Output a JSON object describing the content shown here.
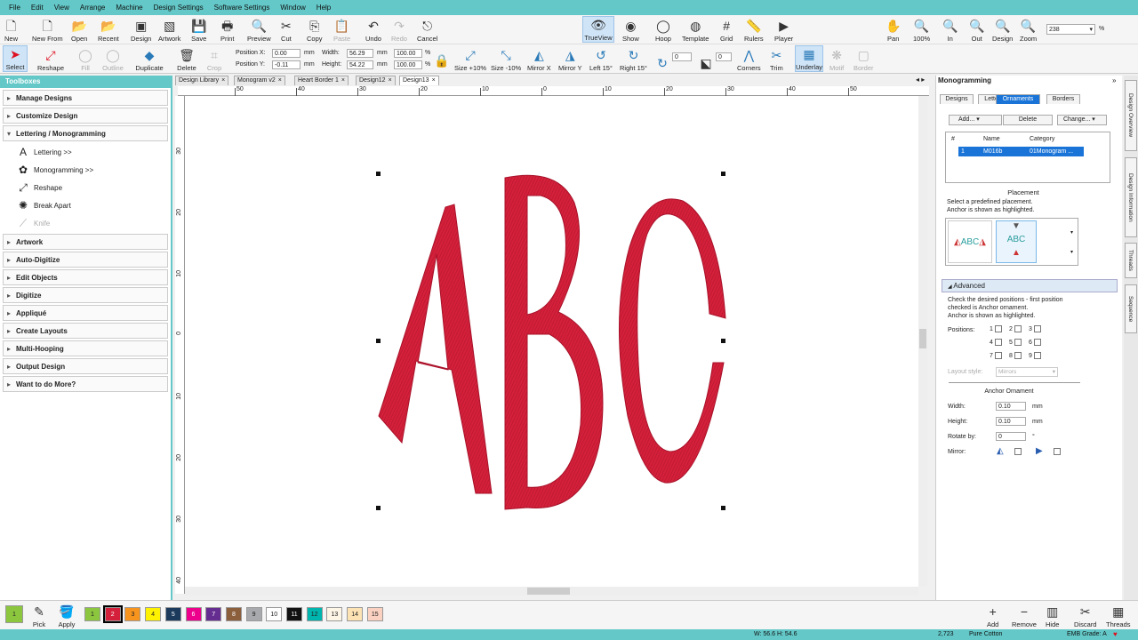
{
  "menu": [
    "File",
    "Edit",
    "View",
    "Arrange",
    "Machine",
    "Design Settings",
    "Software Settings",
    "Window",
    "Help"
  ],
  "toolbar1": {
    "left": [
      {
        "label": "New",
        "icon": "new-icon"
      },
      {
        "label": "New From",
        "icon": "new-from-icon"
      },
      {
        "label": "Open",
        "icon": "open-icon"
      },
      {
        "label": "Recent",
        "icon": "recent-icon"
      },
      {
        "label": "Design",
        "icon": "design-icon"
      },
      {
        "label": "Artwork",
        "icon": "artwork-icon"
      },
      {
        "label": "Save",
        "icon": "save-icon"
      },
      {
        "label": "Print",
        "icon": "print-icon"
      },
      {
        "label": "Preview",
        "icon": "preview-icon"
      },
      {
        "label": "Cut",
        "icon": "cut-icon"
      },
      {
        "label": "Copy",
        "icon": "copy-icon"
      },
      {
        "label": "Paste",
        "icon": "paste-icon"
      },
      {
        "label": "Undo",
        "icon": "undo-icon"
      },
      {
        "label": "Redo",
        "icon": "redo-icon"
      },
      {
        "label": "Cancel",
        "icon": "cancel-icon"
      }
    ],
    "view": [
      {
        "label": "TrueView",
        "icon": "trueview-icon"
      },
      {
        "label": "Show",
        "icon": "show-icon"
      },
      {
        "label": "Hoop",
        "icon": "hoop-icon"
      },
      {
        "label": "Template",
        "icon": "template-icon"
      },
      {
        "label": "Grid",
        "icon": "grid-icon"
      },
      {
        "label": "Rulers",
        "icon": "rulers-icon"
      },
      {
        "label": "Player",
        "icon": "player-icon"
      }
    ],
    "zoom": [
      {
        "label": "Pan",
        "icon": "pan-icon"
      },
      {
        "label": "100%",
        "icon": "zoom-100-icon"
      },
      {
        "label": "In",
        "icon": "zoom-in-icon"
      },
      {
        "label": "Out",
        "icon": "zoom-out-icon"
      },
      {
        "label": "Design",
        "icon": "zoom-design-icon"
      },
      {
        "label": "Zoom",
        "icon": "zoom-icon"
      }
    ],
    "zoom_value": "238",
    "zoom_unit": "%"
  },
  "toolbar2": {
    "select": "Select",
    "reshape": "Reshape",
    "fill": "Fill",
    "outline": "Outline",
    "duplicate": "Duplicate",
    "delete": "Delete",
    "crop": "Crop",
    "pos_x_label": "Position X:",
    "pos_x": "0.00",
    "pos_y_label": "Position Y:",
    "pos_y": "-0.11",
    "mm": "mm",
    "width_label": "Width:",
    "width": "56.29",
    "height_label": "Height:",
    "height": "54.22",
    "scale_w": "100.00",
    "scale_h": "100.00",
    "pct": "%",
    "actions": [
      {
        "label": "Size +10%",
        "icon": "size-up-icon"
      },
      {
        "label": "Size -10%",
        "icon": "size-down-icon"
      },
      {
        "label": "Mirror X",
        "icon": "mirror-x-icon"
      },
      {
        "label": "Mirror Y",
        "icon": "mirror-y-icon"
      },
      {
        "label": "Left 15°",
        "icon": "rotate-left-icon"
      },
      {
        "label": "Right 15°",
        "icon": "rotate-right-icon"
      }
    ],
    "rotate_value": "0",
    "skew_value": "0",
    "right": [
      {
        "label": "Corners",
        "icon": "corners-icon"
      },
      {
        "label": "Trim",
        "icon": "trim-icon"
      },
      {
        "label": "Underlay",
        "icon": "underlay-icon"
      },
      {
        "label": "Motif",
        "icon": "motif-icon"
      },
      {
        "label": "Border",
        "icon": "border-icon"
      }
    ]
  },
  "toolboxes": {
    "title": "Toolboxes",
    "sections_top": [
      "Manage Designs",
      "Customize Design"
    ],
    "open_section": "Lettering / Monogramming",
    "sub_items": [
      {
        "label": "Lettering >>",
        "icon": "lettering-icon"
      },
      {
        "label": "Monogramming >>",
        "icon": "monogramming-icon"
      },
      {
        "label": "Reshape",
        "icon": "reshape-icon"
      },
      {
        "label": "Break Apart",
        "icon": "break-apart-icon"
      },
      {
        "label": "Knife",
        "icon": "knife-icon"
      }
    ],
    "sections_bottom": [
      "Artwork",
      "Auto-Digitize",
      "Edit Objects",
      "Digitize",
      "Appliqué",
      "Create Layouts",
      "Multi-Hooping",
      "Output Design",
      "Want to do More?"
    ]
  },
  "doc_tabs": [
    "Design Library",
    "Monogram v2",
    "Heart Border 1",
    "Design12",
    "Design13"
  ],
  "ruler_top": [
    "50",
    "40",
    "30",
    "20",
    "10",
    "0",
    "10",
    "20",
    "30",
    "40",
    "50"
  ],
  "ruler_left": [
    "30",
    "20",
    "10",
    "0",
    "10",
    "20",
    "30",
    "40"
  ],
  "design_text": "ABC",
  "design_color": "#d4203a",
  "right_panel": {
    "title": "Monogramming",
    "tabs": [
      "Designs",
      "Letters",
      "Ornaments",
      "Borders"
    ],
    "active_tab": "Ornaments",
    "buttons": {
      "add": "Add...",
      "delete": "Delete",
      "change": "Change..."
    },
    "table_headers": [
      "#",
      "Name",
      "Category"
    ],
    "table_rows": [
      {
        "num": "1",
        "name": "M016b",
        "category": "01Monogram ..."
      }
    ],
    "placement_title": "Placement",
    "placement_desc1": "Select a predefined placement.",
    "placement_desc2": "Anchor is shown as highlighted.",
    "preview_text": "ABC",
    "advanced_title": "Advanced",
    "advanced_desc1": "Check the desired positions - first position",
    "advanced_desc2": "checked is Anchor ornament.",
    "advanced_desc3": "Anchor is shown as highlighted.",
    "positions_label": "Positions:",
    "positions": [
      "1",
      "2",
      "3",
      "4",
      "5",
      "6",
      "7",
      "8",
      "9"
    ],
    "layout_style_label": "Layout style:",
    "layout_style_value": "Mirrors",
    "anchor_title": "Anchor Ornament",
    "width_label": "Width:",
    "width_value": "0.10",
    "mm": "mm",
    "height_label": "Height:",
    "height_value": "0.10",
    "rotate_label": "Rotate by:",
    "rotate_value": "0",
    "deg": "°",
    "mirror_label": "Mirror:"
  },
  "side_tabs": [
    "Design Overview",
    "Design Information",
    "Threads",
    "Sequence"
  ],
  "bottom": {
    "pick": "Pick",
    "apply": "Apply",
    "swatches": [
      {
        "n": "1",
        "c": "#8cc63f"
      },
      {
        "n": "2",
        "c": "#d4203a"
      },
      {
        "n": "3",
        "c": "#f7941d"
      },
      {
        "n": "4",
        "c": "#fff200"
      },
      {
        "n": "5",
        "c": "#1b3a5c"
      },
      {
        "n": "6",
        "c": "#ec008c"
      },
      {
        "n": "7",
        "c": "#662d91"
      },
      {
        "n": "8",
        "c": "#8b5e3c"
      },
      {
        "n": "9",
        "c": "#a7a9ac"
      },
      {
        "n": "10",
        "c": "#ffffff"
      },
      {
        "n": "11",
        "c": "#111111"
      },
      {
        "n": "12",
        "c": "#00b5ad"
      },
      {
        "n": "13",
        "c": "#fdf5e6"
      },
      {
        "n": "14",
        "c": "#fde3b4"
      },
      {
        "n": "15",
        "c": "#fbd2c2"
      }
    ],
    "right": [
      {
        "label": "Add",
        "icon": "add-icon"
      },
      {
        "label": "Remove",
        "icon": "remove-icon"
      },
      {
        "label": "Hide",
        "icon": "hide-icon"
      },
      {
        "label": "Discard",
        "icon": "discard-icon"
      },
      {
        "label": "Threads",
        "icon": "threads-icon"
      }
    ]
  },
  "status": {
    "size": "W: 56.6 H: 54.6",
    "stitches": "2,723",
    "thread": "Pure Cotton",
    "grade": "EMB Grade: A"
  }
}
